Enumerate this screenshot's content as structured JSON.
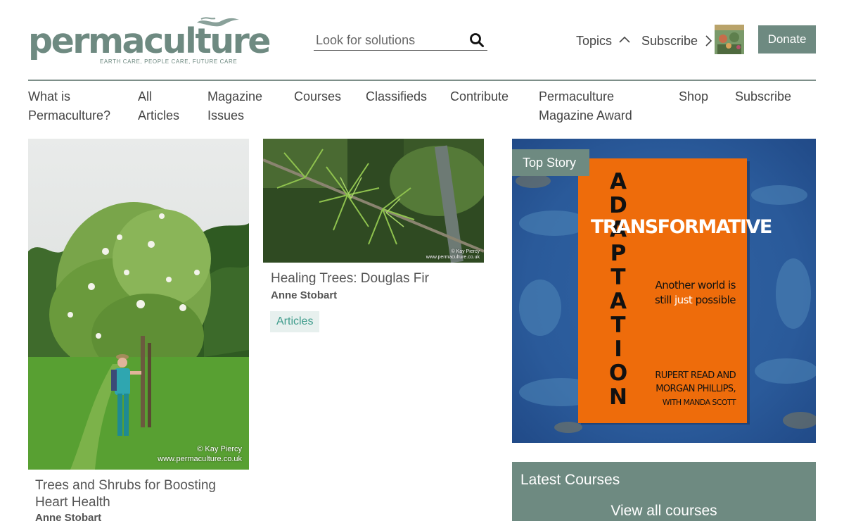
{
  "brand": {
    "name": "permaculture",
    "tagline": "EARTH CARE, PEOPLE CARE, FUTURE CARE",
    "color": "#6e8a81"
  },
  "search": {
    "placeholder": "Look for solutions",
    "icon": "search-icon"
  },
  "header": {
    "topics_label": "Topics",
    "subscribe_label": "Subscribe",
    "donate_label": "Donate"
  },
  "nav": {
    "items": [
      "What is Permaculture?",
      "All Articles",
      "Magazine Issues",
      "Courses",
      "Classifieds",
      "Contribute",
      "Permaculture Magazine Award",
      "Shop",
      "Subscribe"
    ]
  },
  "articles": [
    {
      "title": "Trees and Shrubs for Boosting Heart Health",
      "author": "Anne Stobart",
      "credit_line1": "© Kay Piercy",
      "credit_line2": "www.permaculture.co.uk"
    },
    {
      "title": "Healing Trees: Douglas Fir",
      "author": "Anne Stobart",
      "tag": "Articles",
      "credit_line1": "© Kay Piercy",
      "credit_line2": "www.permaculture.co.uk"
    }
  ],
  "top_story": {
    "badge": "Top Story",
    "book": {
      "word_vertical": "ADAPTATION",
      "word_horizontal": "TRANSFORMATIVE",
      "subtitle_1": "Another world is",
      "subtitle_2a": "still ",
      "subtitle_2b": "just",
      "subtitle_2c": " possible",
      "author_1": "RUPERT READ AND",
      "author_2": "MORGAN PHILLIPS,",
      "author_3": "WITH MANDA SCOTT"
    }
  },
  "courses": {
    "title": "Latest Courses",
    "view_all": "View all courses"
  }
}
